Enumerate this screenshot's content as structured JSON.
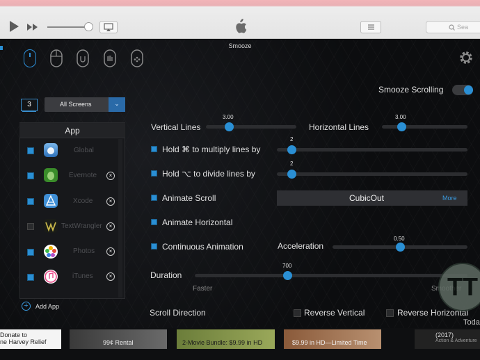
{
  "itunes": {
    "search_placeholder": "Sea"
  },
  "window": {
    "title": "Smooze"
  },
  "toolbar": {
    "tabs": [
      "mouse-scroll",
      "mouse-buttons",
      "mouse-magnet",
      "mouse-hand",
      "mouse-gestures"
    ],
    "active_tab": 0
  },
  "screens": {
    "count": "3",
    "selected": "All Screens"
  },
  "applist": {
    "header": "App",
    "items": [
      {
        "name": "Global",
        "checked": true,
        "removable": false
      },
      {
        "name": "Evernote",
        "checked": true,
        "removable": true
      },
      {
        "name": "Xcode",
        "checked": true,
        "removable": true
      },
      {
        "name": "TextWrangler",
        "checked": false,
        "removable": true
      },
      {
        "name": "Photos",
        "checked": true,
        "removable": true
      },
      {
        "name": "iTunes",
        "checked": true,
        "removable": true
      }
    ],
    "add_label": "Add App"
  },
  "settings": {
    "smooze_scrolling_label": "Smooze Scrolling",
    "smooze_scrolling_on": true,
    "vertical_lines_label": "Vertical Lines",
    "vertical_lines_value": "3.00",
    "horizontal_lines_label": "Horizontal Lines",
    "horizontal_lines_value": "3.00",
    "multiply_label": "Hold ⌘ to multiply lines by",
    "multiply_value": "2",
    "divide_label": "Hold ⌥ to divide lines by",
    "divide_value": "2",
    "animate_scroll_label": "Animate Scroll",
    "easing_value": "CubicOut",
    "easing_more": "More",
    "animate_horizontal_label": "Animate Horizontal",
    "continuous_label": "Continuous Animation",
    "acceleration_label": "Acceleration",
    "acceleration_value": "0.50",
    "duration_label": "Duration",
    "duration_value": "700",
    "faster_label": "Faster",
    "smoother_label": "Smoother",
    "scroll_direction_label": "Scroll Direction",
    "reverse_vertical_label": "Reverse Vertical",
    "reverse_horizontal_label": "Reverse Horizontal"
  },
  "store_strip": {
    "cards": [
      {
        "line1": "Donate to",
        "line2": "ne Harvey Relief"
      },
      {
        "line1": "99¢ Rental",
        "line2": ""
      },
      {
        "line1": "2-Movie Bundle: $9.99 in HD",
        "line2": ""
      },
      {
        "line1": "$9.99 in HD—Limited Time",
        "line2": ""
      },
      {
        "line1": "(2017)",
        "line2": "Action & Adventure"
      }
    ]
  },
  "watermark": {
    "text": "TT",
    "caption": "Toda"
  },
  "colors": {
    "accent": "#2a8fd4",
    "panel_bg": "#0c0d0f"
  }
}
